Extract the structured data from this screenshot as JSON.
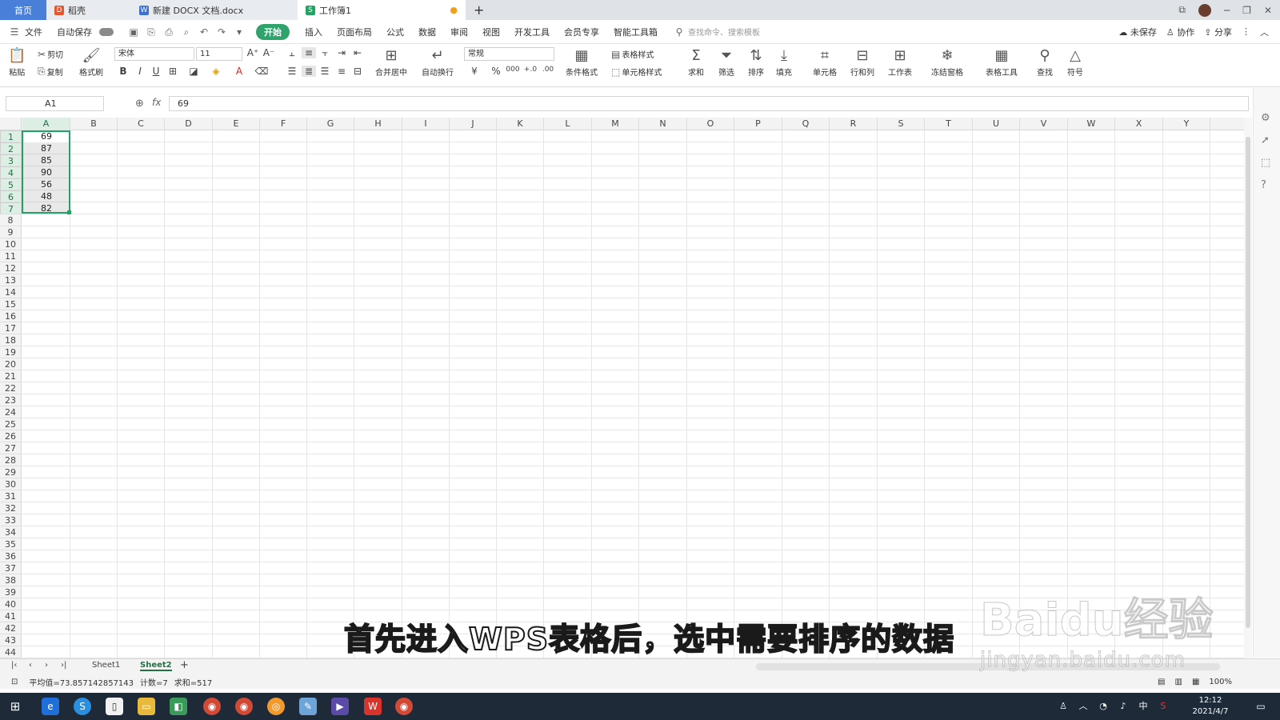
{
  "tabs": {
    "home": "首页",
    "t1": "稻壳",
    "t2": "新建 DOCX 文档.docx",
    "t3": "工作簿1",
    "new": "+"
  },
  "menu": {
    "file": "文件",
    "autosave": "自动保存",
    "items": [
      "开始",
      "插入",
      "页面布局",
      "公式",
      "数据",
      "审阅",
      "视图",
      "开发工具",
      "会员专享",
      "智能工具箱"
    ],
    "search_placeholder": "查找命令、搜索模板",
    "unsaved": "未保存",
    "collab": "协作",
    "share": "分享"
  },
  "ribbon": {
    "paste": "粘贴",
    "cut": "剪切",
    "copy": "复制",
    "format_painter": "格式刷",
    "font": "宋体",
    "size": "11",
    "merge": "合并居中",
    "wrap": "自动换行",
    "numfmt": "常规",
    "cond": "条件格式",
    "table_style": "表格样式",
    "cell_style": "单元格样式",
    "sum": "求和",
    "filter": "筛选",
    "sort": "排序",
    "fill": "填充",
    "cell": "单元格",
    "rowcol": "行和列",
    "sheet": "工作表",
    "freeze": "冻结窗格",
    "tools": "表格工具",
    "find": "查找",
    "symbol": "符号",
    "currency": "¥",
    "percent": "%",
    "thousand": "000",
    "inc_dec": "+.0",
    "dec_dec": ".00"
  },
  "formula": {
    "cellref": "A1",
    "fx": "fx",
    "value": "69"
  },
  "columns": [
    "A",
    "B",
    "C",
    "D",
    "E",
    "F",
    "G",
    "H",
    "I",
    "J",
    "K",
    "L",
    "M",
    "N",
    "O",
    "P",
    "Q",
    "R",
    "S",
    "T",
    "U",
    "V",
    "W",
    "X",
    "Y"
  ],
  "values": [
    "69",
    "87",
    "85",
    "90",
    "56",
    "48",
    "82"
  ],
  "sheets": {
    "s1": "Sheet1",
    "s2": "Sheet2",
    "add": "+"
  },
  "status": {
    "avg": "平均值=73.857142857143",
    "count": "计数=7",
    "sum": "求和=517",
    "zoom": "100%"
  },
  "clock": {
    "time": "12:12",
    "date": "2021/4/7",
    "ime": "中"
  },
  "subtitle": "首先进入WPS表格后，选中需要排序的数据",
  "watermark": {
    "logo": "Baidu经验",
    "url": "jingyan.baidu.com"
  }
}
